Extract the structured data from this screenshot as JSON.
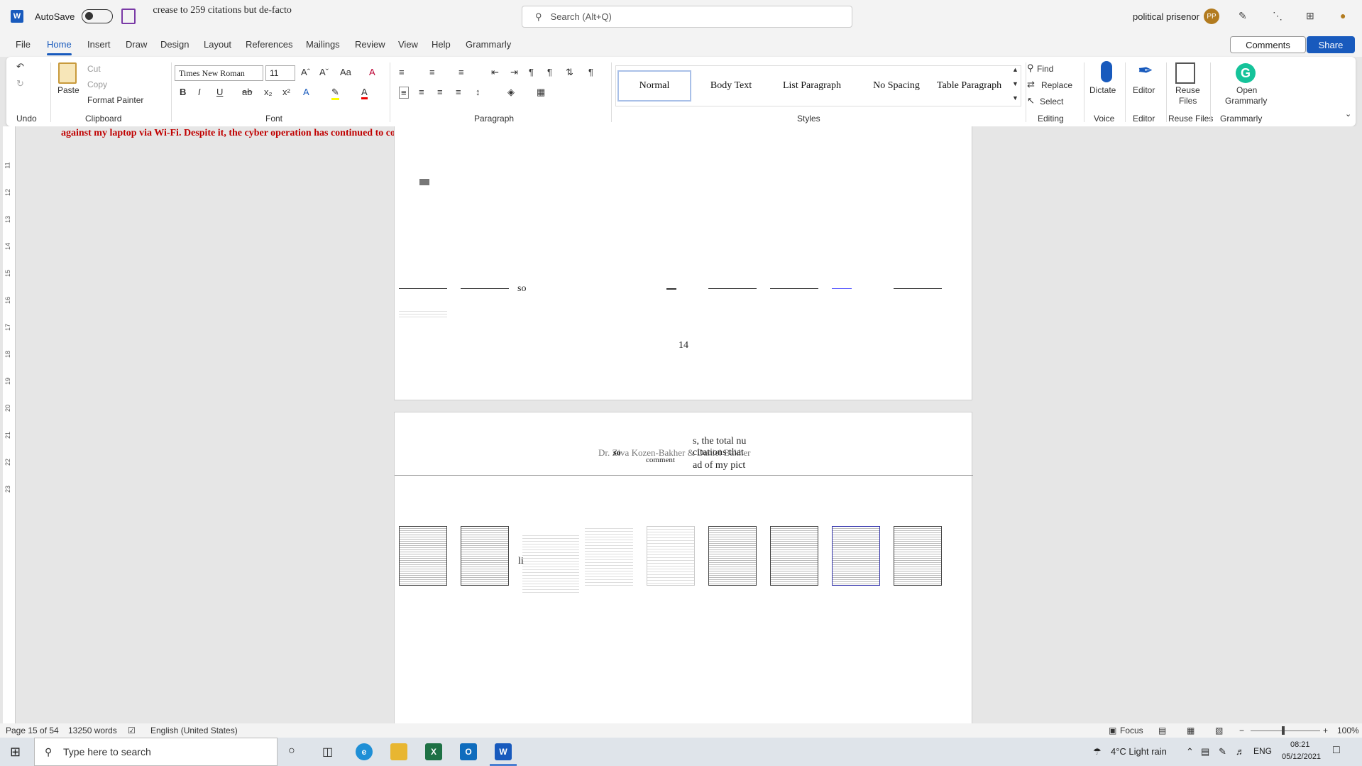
{
  "titlebar": {
    "autosave_label": "AutoSave",
    "doc_title": "crease to 259 citations but de-facto",
    "search_placeholder": "Search (Alt+Q)",
    "user_name": "political prisenor",
    "user_initials": "PP"
  },
  "tabs": [
    "File",
    "Home",
    "Insert",
    "Draw",
    "Design",
    "Layout",
    "References",
    "Mailings",
    "Review",
    "View",
    "Help",
    "Grammarly"
  ],
  "actions": {
    "comments": "Comments",
    "share": "Share"
  },
  "ribbon": {
    "undo_label": "Undo",
    "clipboard": {
      "paste": "Paste",
      "cut": "Cut",
      "copy": "Copy",
      "format_painter": "Format Painter",
      "label": "Clipboard"
    },
    "font": {
      "name": "Times New Roman",
      "size": "11",
      "label": "Font"
    },
    "paragraph_label": "Paragraph",
    "styles": {
      "items": [
        "Normal",
        "Body Text",
        "List Paragraph",
        "No Spacing",
        "Table Paragraph"
      ],
      "label": "Styles"
    },
    "editing": {
      "find": "Find",
      "replace": "Replace",
      "select": "Select",
      "label": "Editing"
    },
    "voice": {
      "dictate": "Dictate",
      "label": "Voice"
    },
    "editor": {
      "button": "Editor",
      "label": "Editor"
    },
    "reuse": {
      "button_line1": "Reuse",
      "button_line2": "Files",
      "label": "Reuse Files"
    },
    "grammarly": {
      "button_line1": "Open",
      "button_line2": "Grammarly",
      "label": "Grammarly"
    }
  },
  "document": {
    "red_text": "against my laptop via Wi-Fi. Despite it, the cyber operation has continued to conduct against",
    "page_number": "14",
    "so_text": "so",
    "header_fragments": {
      "line1": "s, the total nu",
      "line2": "citations that",
      "line3": "ad of my pict",
      "names": "Dr. Ziva Kozen-Bakher & Daniel Bakher",
      "comment": "comment",
      "so2": "so",
      "li": "li"
    },
    "ruler_numbers": [
      "11",
      "12",
      "13",
      "14",
      "15",
      "16",
      "17",
      "18",
      "19",
      "20",
      "21",
      "22",
      "23"
    ]
  },
  "statusbar": {
    "page": "Page 15 of 54",
    "words": "13250 words",
    "language": "English (United States)",
    "focus": "Focus",
    "zoom": "100%"
  },
  "taskbar": {
    "search_placeholder": "Type here to search",
    "weather": "4°C  Light rain",
    "lang": "ENG",
    "time": "08:21",
    "date": "05/12/2021"
  }
}
